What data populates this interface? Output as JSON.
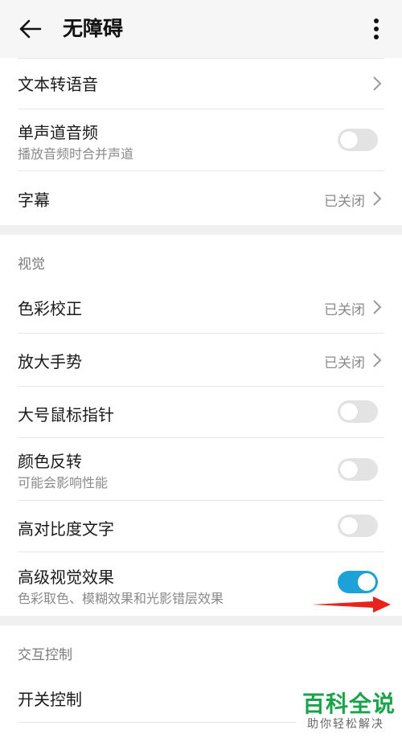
{
  "header": {
    "title": "无障碍",
    "back_icon": "arrow-left-icon",
    "more_icon": "more-vertical-icon"
  },
  "audio": {
    "text_to_speech": {
      "title": "文本转语音"
    },
    "mono_audio": {
      "title": "单声道音频",
      "subtitle": "播放音频时合并声道",
      "enabled": false
    },
    "captions": {
      "title": "字幕",
      "status": "已关闭"
    }
  },
  "visual": {
    "label": "视觉",
    "color_correction": {
      "title": "色彩校正",
      "status": "已关闭"
    },
    "magnification": {
      "title": "放大手势",
      "status": "已关闭"
    },
    "large_pointer": {
      "title": "大号鼠标指针",
      "enabled": false
    },
    "color_inversion": {
      "title": "颜色反转",
      "subtitle": "可能会影响性能",
      "enabled": false
    },
    "high_contrast_text": {
      "title": "高对比度文字",
      "enabled": false
    },
    "advanced_visual": {
      "title": "高级视觉效果",
      "subtitle": "色彩取色、模糊效果和光影错层效果",
      "enabled": true
    }
  },
  "interaction": {
    "label": "交互控制",
    "switch_control": {
      "title": "开关控制"
    }
  },
  "watermark": {
    "brand": "百科全说",
    "slogan": "助你轻松解决"
  },
  "colors": {
    "toggle_on": "#1da2d8",
    "toggle_off": "#e3e3e3",
    "annotation_arrow": "#e8231b",
    "watermark_green": "#1aa34a"
  }
}
